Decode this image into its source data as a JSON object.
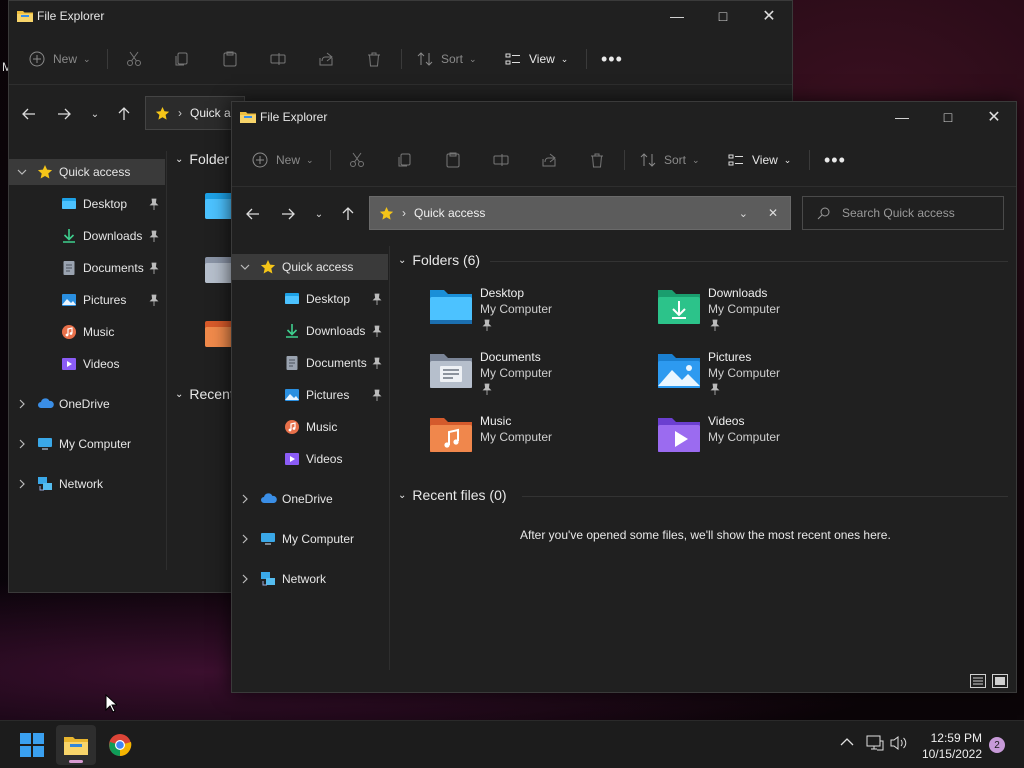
{
  "desktop": {
    "edge_letter": "M"
  },
  "back_window": {
    "title": "File Explorer",
    "toolbar": {
      "new": "New",
      "sort": "Sort",
      "view": "View"
    },
    "address": "Quick a",
    "sidebar": [
      {
        "label": "Quick access",
        "icon": "star-icon",
        "selected": true
      },
      {
        "label": "Desktop",
        "icon": "desktop-folder-icon",
        "pinned": true
      },
      {
        "label": "Downloads",
        "icon": "download-icon",
        "pinned": true
      },
      {
        "label": "Documents",
        "icon": "documents-icon",
        "pinned": true
      },
      {
        "label": "Pictures",
        "icon": "pictures-icon",
        "pinned": true
      },
      {
        "label": "Music",
        "icon": "music-icon"
      },
      {
        "label": "Videos",
        "icon": "videos-icon"
      },
      {
        "label": "OneDrive",
        "icon": "cloud-icon"
      },
      {
        "label": "My Computer",
        "icon": "computer-icon"
      },
      {
        "label": "Network",
        "icon": "network-icon"
      }
    ],
    "folders_head": "Folder",
    "recent_head": "Recent"
  },
  "front_window": {
    "title": "File Explorer",
    "toolbar": {
      "new": "New",
      "sort": "Sort",
      "view": "View"
    },
    "address": "Quick access",
    "search_placeholder": "Search Quick access",
    "sidebar": [
      {
        "label": "Quick access",
        "icon": "star-icon",
        "selected": true
      },
      {
        "label": "Desktop",
        "icon": "desktop-folder-icon",
        "pinned": true
      },
      {
        "label": "Downloads",
        "icon": "download-icon",
        "pinned": true
      },
      {
        "label": "Documents",
        "icon": "documents-icon",
        "pinned": true
      },
      {
        "label": "Pictures",
        "icon": "pictures-icon",
        "pinned": true
      },
      {
        "label": "Music",
        "icon": "music-icon"
      },
      {
        "label": "Videos",
        "icon": "videos-icon"
      },
      {
        "label": "OneDrive",
        "icon": "cloud-icon"
      },
      {
        "label": "My Computer",
        "icon": "computer-icon"
      },
      {
        "label": "Network",
        "icon": "network-icon"
      }
    ],
    "folders_head": "Folders (6)",
    "folders": [
      {
        "name": "Desktop",
        "location": "My Computer",
        "pinned": true,
        "icon": "desktop-folder-icon"
      },
      {
        "name": "Downloads",
        "location": "My Computer",
        "pinned": true,
        "icon": "downloads-folder-icon"
      },
      {
        "name": "Documents",
        "location": "My Computer",
        "pinned": true,
        "icon": "documents-folder-icon"
      },
      {
        "name": "Pictures",
        "location": "My Computer",
        "pinned": true,
        "icon": "pictures-folder-icon"
      },
      {
        "name": "Music",
        "location": "My Computer",
        "pinned": false,
        "icon": "music-folder-icon"
      },
      {
        "name": "Videos",
        "location": "My Computer",
        "pinned": false,
        "icon": "videos-folder-icon"
      }
    ],
    "recent_head": "Recent files (0)",
    "recent_empty": "After you've opened some files, we'll show the most recent ones here."
  },
  "taskbar": {
    "time": "12:59 PM",
    "date": "10/15/2022",
    "notifications": "2"
  },
  "colors": {
    "accent": "#4cc2ff",
    "selection": "#3a3a3a",
    "taskbar": "#1c1c1c"
  }
}
